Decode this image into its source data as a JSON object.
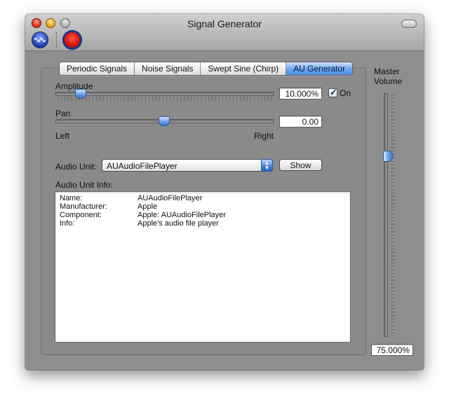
{
  "window": {
    "title": "Signal Generator"
  },
  "tabs": [
    {
      "label": "Periodic Signals",
      "selected": false
    },
    {
      "label": "Noise Signals",
      "selected": false
    },
    {
      "label": "Swept Sine (Chirp)",
      "selected": false
    },
    {
      "label": "AU Generator",
      "selected": true
    }
  ],
  "amplitude": {
    "label": "Amplitude",
    "value": "10.000%",
    "level": 0.1
  },
  "on_checkbox": {
    "label": "On",
    "checked": true
  },
  "pan": {
    "label": "Pan",
    "value": "0.00",
    "left_label": "Left",
    "right_label": "Right",
    "level": 0.5
  },
  "audio_unit": {
    "label": "Audio Unit:",
    "selected": "AUAudioFilePlayer",
    "show_button": "Show"
  },
  "audio_unit_info": {
    "label": "Audio Unit Info:",
    "rows": [
      {
        "key": "Name:",
        "value": "AUAudioFilePlayer"
      },
      {
        "key": "Manufacturer:",
        "value": "Apple"
      },
      {
        "key": "Component:",
        "value": "Apple: AUAudioFilePlayer"
      },
      {
        "key": "Info:",
        "value": "Apple's audio file player"
      }
    ]
  },
  "master_volume": {
    "label_line1": "Master",
    "label_line2": "Volume",
    "value": "75.000%",
    "level": 0.75
  },
  "icons": [
    "waveform-icon",
    "record-icon"
  ],
  "colors": {
    "selected_tab": "#4d8de0",
    "record": "#d80f00",
    "window_bg": "#8e8e8e"
  }
}
